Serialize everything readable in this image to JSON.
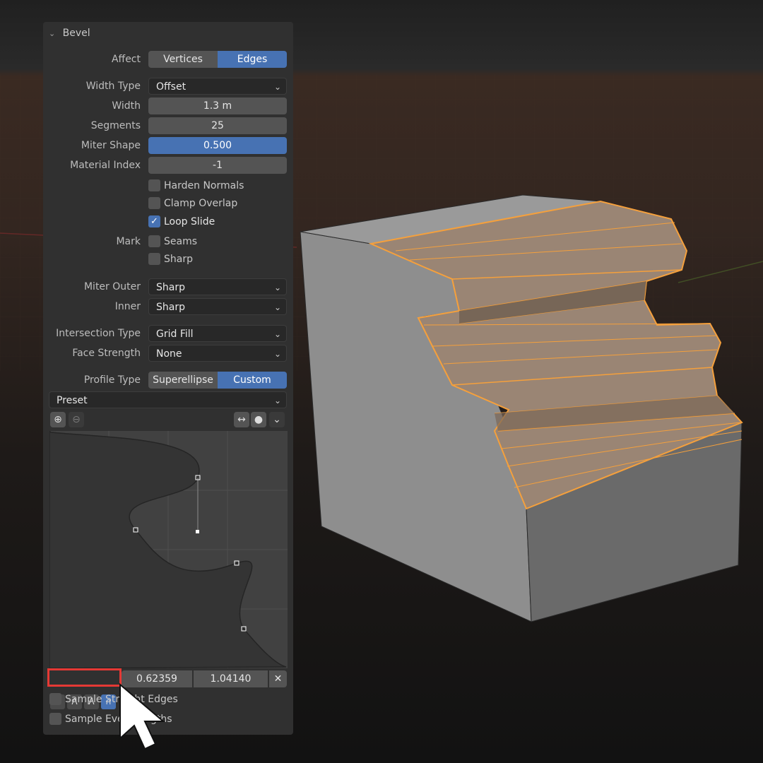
{
  "panel": {
    "title": "Bevel",
    "affect": {
      "label": "Affect",
      "options": [
        "Vertices",
        "Edges"
      ],
      "selected": "Edges"
    },
    "width_type": {
      "label": "Width Type",
      "value": "Offset"
    },
    "width": {
      "label": "Width",
      "value": "1.3 m"
    },
    "segments": {
      "label": "Segments",
      "value": "25"
    },
    "miter_shape": {
      "label": "Miter Shape",
      "value": "0.500"
    },
    "material_index": {
      "label": "Material Index",
      "value": "-1"
    },
    "harden_normals": {
      "label": "Harden Normals",
      "checked": false
    },
    "clamp_overlap": {
      "label": "Clamp Overlap",
      "checked": false
    },
    "loop_slide": {
      "label": "Loop Slide",
      "checked": true
    },
    "mark": {
      "label": "Mark",
      "seams": "Seams",
      "sharp": "Sharp"
    },
    "miter_outer": {
      "label": "Miter Outer",
      "value": "Sharp"
    },
    "inner": {
      "label": "Inner",
      "value": "Sharp"
    },
    "intersection_type": {
      "label": "Intersection Type",
      "value": "Grid Fill"
    },
    "face_strength": {
      "label": "Face Strength",
      "value": "None"
    },
    "profile_type": {
      "label": "Profile Type",
      "options": [
        "Superellipse",
        "Custom"
      ],
      "selected": "Custom"
    },
    "preset": {
      "label": "Preset"
    },
    "point_x": "0.62359",
    "point_y": "1.04140",
    "sample_straight": "Sample Straight Edges",
    "sample_even": "Sample Even Lengths"
  },
  "icons": {
    "zoom_in": "zoom-in-icon",
    "zoom_out": "zoom-out-icon",
    "reset_view": "horizontal-arrows-icon",
    "dot": "dot-icon",
    "chevron": "chevron-down-icon",
    "handle_free": "handle-free-icon",
    "handle_vector": "handle-vector-icon",
    "handle_auto": "handle-auto-icon",
    "handle_auto_clamped": "handle-auto-clamped-icon",
    "delete": "close-icon",
    "cursor": "mouse-cursor-icon"
  },
  "colors": {
    "accent": "#4772b3",
    "highlight": "#e53935",
    "selection": "#f5a03c"
  }
}
